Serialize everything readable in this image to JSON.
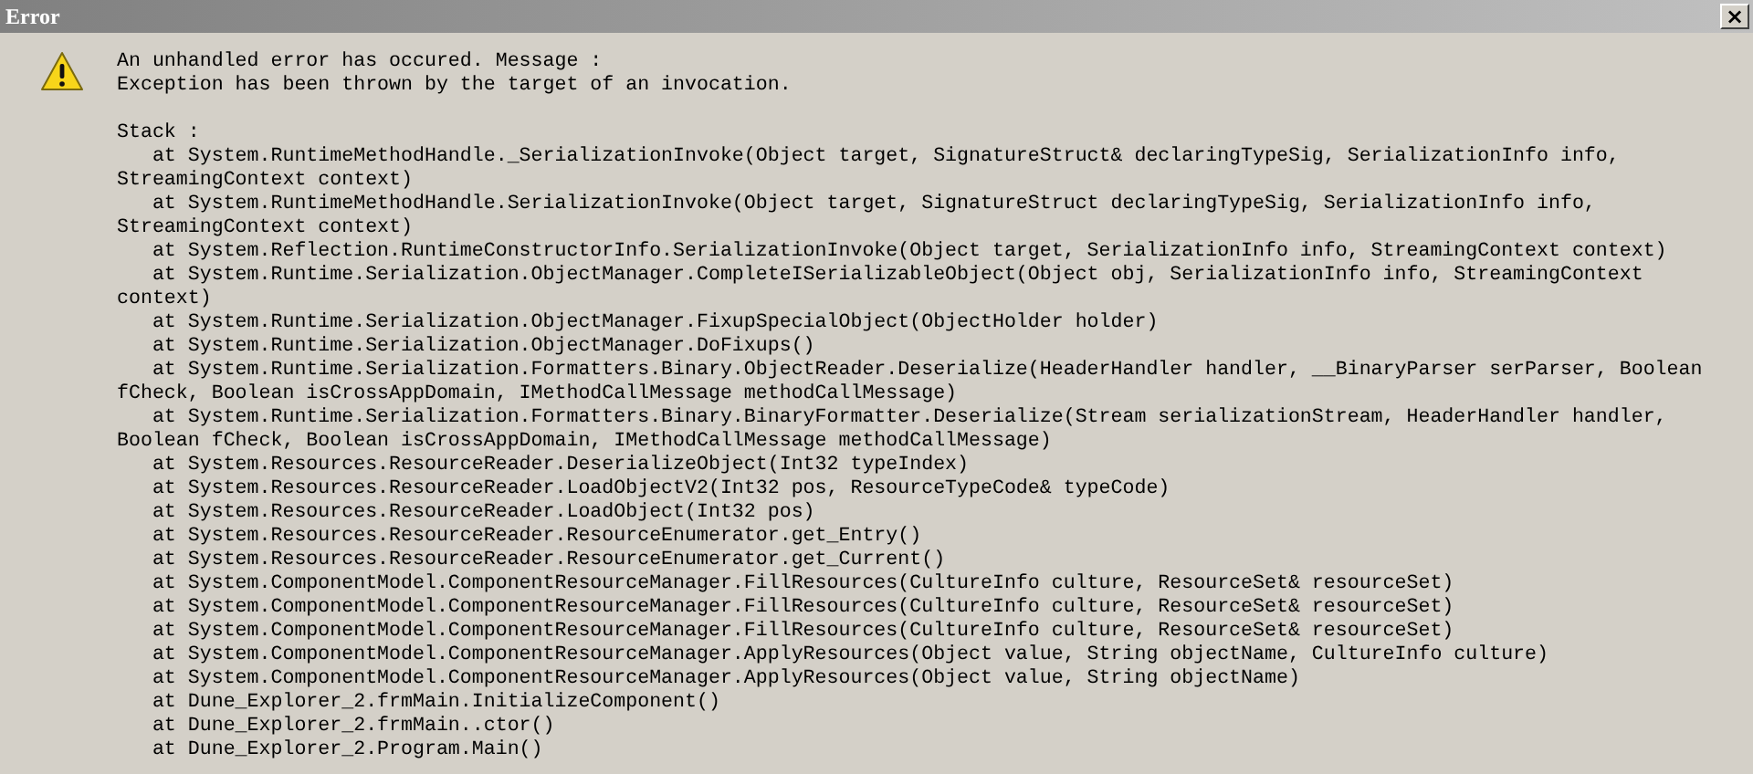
{
  "window": {
    "title": "Error",
    "close": "×"
  },
  "message": [
    "An unhandled error has occured. Message :",
    "Exception has been thrown by the target of an invocation."
  ],
  "stack_label": "Stack :",
  "stack": [
    "   at System.RuntimeMethodHandle._SerializationInvoke(Object target, SignatureStruct& declaringTypeSig, SerializationInfo info, StreamingContext context)",
    "   at System.RuntimeMethodHandle.SerializationInvoke(Object target, SignatureStruct declaringTypeSig, SerializationInfo info, StreamingContext context)",
    "   at System.Reflection.RuntimeConstructorInfo.SerializationInvoke(Object target, SerializationInfo info, StreamingContext context)",
    "   at System.Runtime.Serialization.ObjectManager.CompleteISerializableObject(Object obj, SerializationInfo info, StreamingContext context)",
    "   at System.Runtime.Serialization.ObjectManager.FixupSpecialObject(ObjectHolder holder)",
    "   at System.Runtime.Serialization.ObjectManager.DoFixups()",
    "   at System.Runtime.Serialization.Formatters.Binary.ObjectReader.Deserialize(HeaderHandler handler, __BinaryParser serParser, Boolean fCheck, Boolean isCrossAppDomain, IMethodCallMessage methodCallMessage)",
    "   at System.Runtime.Serialization.Formatters.Binary.BinaryFormatter.Deserialize(Stream serializationStream, HeaderHandler handler, Boolean fCheck, Boolean isCrossAppDomain, IMethodCallMessage methodCallMessage)",
    "   at System.Resources.ResourceReader.DeserializeObject(Int32 typeIndex)",
    "   at System.Resources.ResourceReader.LoadObjectV2(Int32 pos, ResourceTypeCode& typeCode)",
    "   at System.Resources.ResourceReader.LoadObject(Int32 pos)",
    "   at System.Resources.ResourceReader.ResourceEnumerator.get_Entry()",
    "   at System.Resources.ResourceReader.ResourceEnumerator.get_Current()",
    "   at System.ComponentModel.ComponentResourceManager.FillResources(CultureInfo culture, ResourceSet& resourceSet)",
    "   at System.ComponentModel.ComponentResourceManager.FillResources(CultureInfo culture, ResourceSet& resourceSet)",
    "   at System.ComponentModel.ComponentResourceManager.FillResources(CultureInfo culture, ResourceSet& resourceSet)",
    "   at System.ComponentModel.ComponentResourceManager.ApplyResources(Object value, String objectName, CultureInfo culture)",
    "   at System.ComponentModel.ComponentResourceManager.ApplyResources(Object value, String objectName)",
    "   at Dune_Explorer_2.frmMain.InitializeComponent()",
    "   at Dune_Explorer_2.frmMain..ctor()",
    "   at Dune_Explorer_2.Program.Main()"
  ]
}
